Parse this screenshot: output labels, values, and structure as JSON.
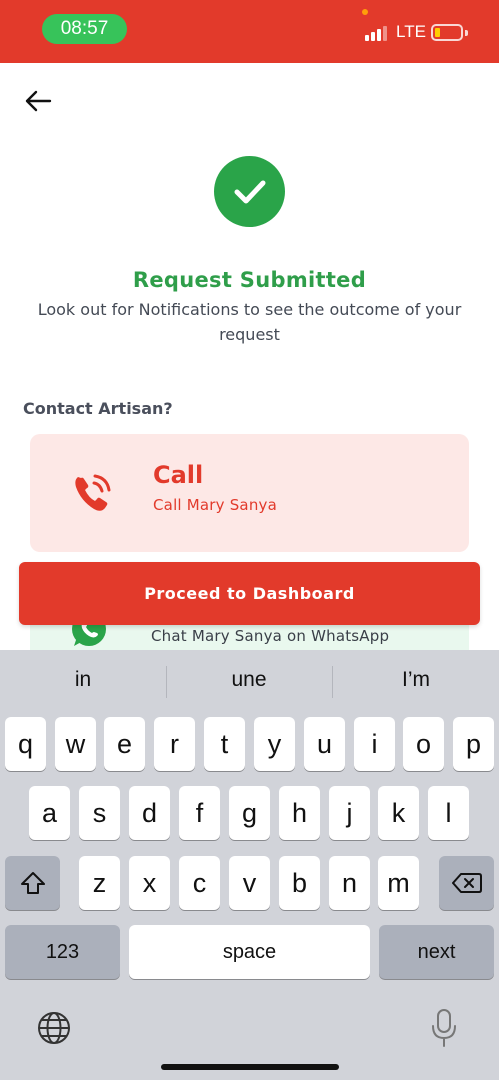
{
  "status_bar": {
    "time": "08:57",
    "network": "LTE",
    "colors": {
      "bar": "#e23a2b",
      "time_pill": "#37c35a"
    }
  },
  "header": {
    "back_icon": "arrow-left-icon"
  },
  "success": {
    "icon": "checkmark-icon",
    "title": "Request Submitted",
    "subtitle": "Look out for Notifications to see the outcome of your request",
    "color": "#2aa449"
  },
  "contact": {
    "label": "Contact Artisan?",
    "call": {
      "icon": "phone-ringing-icon",
      "title": "Call",
      "subtitle": "Call Mary Sanya"
    },
    "whatsapp": {
      "icon": "whatsapp-icon",
      "subtitle": "Chat Mary Sanya on WhatsApp"
    }
  },
  "actions": {
    "proceed_label": "Proceed to Dashboard",
    "accent": "#e23a2b"
  },
  "keyboard": {
    "suggestions": [
      "in",
      "une",
      "I’m"
    ],
    "row1": [
      "q",
      "w",
      "e",
      "r",
      "t",
      "y",
      "u",
      "i",
      "o",
      "p"
    ],
    "row2": [
      "a",
      "s",
      "d",
      "f",
      "g",
      "h",
      "j",
      "k",
      "l"
    ],
    "row3": [
      "z",
      "x",
      "c",
      "v",
      "b",
      "n",
      "m"
    ],
    "numbers_label": "123",
    "space_label": "space",
    "next_label": "next",
    "shift_icon": "shift-icon",
    "delete_icon": "backspace-icon",
    "globe_icon": "globe-icon",
    "mic_icon": "microphone-icon"
  }
}
